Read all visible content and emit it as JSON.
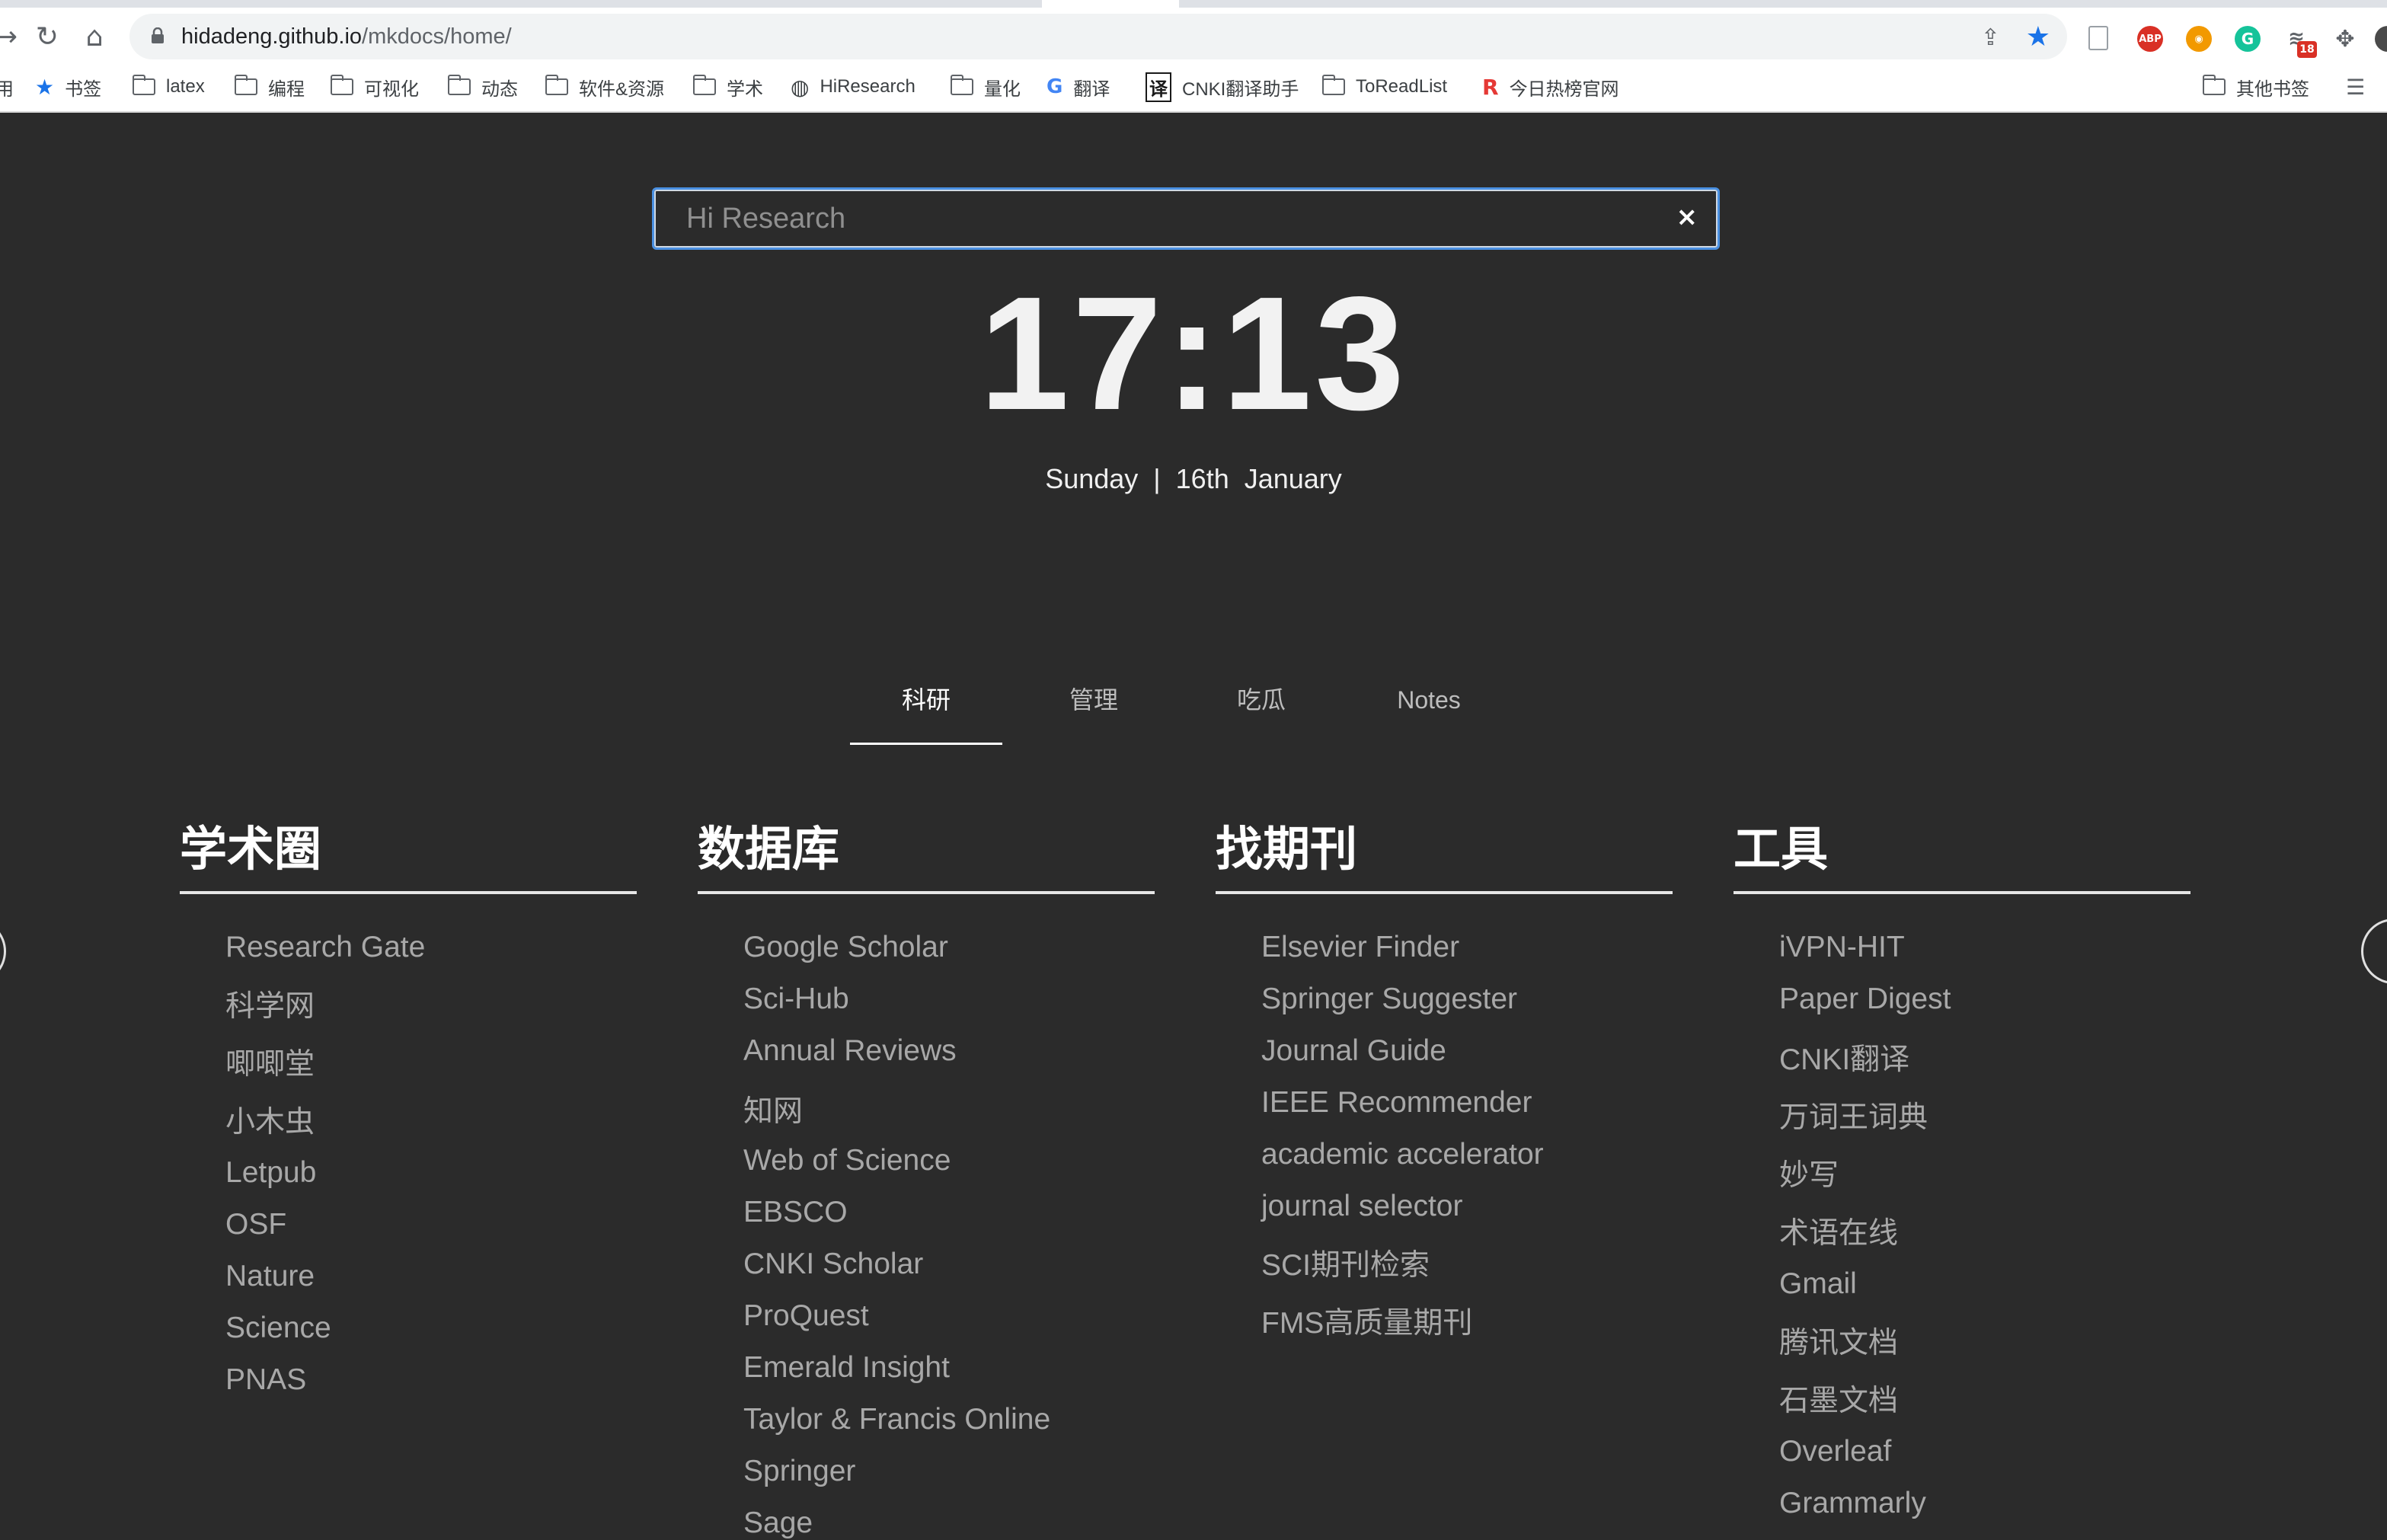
{
  "browser": {
    "url_host": "hidadeng.github.io",
    "url_path": "/mkdocs/home/",
    "extensions": [
      {
        "name": "page-icon"
      },
      {
        "name": "abp-icon",
        "label": "ABP",
        "color": "#d93025"
      },
      {
        "name": "rss-icon",
        "color": "#f29900"
      },
      {
        "name": "grammarly-icon",
        "label": "G",
        "color": "#15c39a"
      },
      {
        "name": "cast-icon",
        "badge": "18",
        "color": "#d93025"
      },
      {
        "name": "puzzle-icon"
      }
    ],
    "bookmarks": [
      {
        "label": "书签",
        "icon": "star-icon"
      },
      {
        "label": "latex",
        "icon": "folder-icon"
      },
      {
        "label": "编程",
        "icon": "folder-icon"
      },
      {
        "label": "可视化",
        "icon": "folder-icon"
      },
      {
        "label": "动态",
        "icon": "folder-icon"
      },
      {
        "label": "软件&资源",
        "icon": "folder-icon"
      },
      {
        "label": "学术",
        "icon": "folder-icon"
      },
      {
        "label": "HiResearch",
        "icon": "globe-icon"
      },
      {
        "label": "量化",
        "icon": "folder-icon"
      },
      {
        "label": "翻译",
        "icon": "translate-icon"
      },
      {
        "label": "CNKI翻译助手",
        "icon": "cnki-icon"
      },
      {
        "label": "ToReadList",
        "icon": "folder-icon"
      },
      {
        "label": "今日热榜官网",
        "icon": "r-icon"
      }
    ],
    "bookmarks_left_edge": "用",
    "other_bookmarks": "其他书签"
  },
  "search": {
    "placeholder": "Hi Research",
    "clear_label": "×"
  },
  "clock": {
    "time": "17:13",
    "date": "Sunday  |  16th  January"
  },
  "tabs": [
    "科研",
    "管理",
    "吃瓜",
    "Notes"
  ],
  "columns": [
    {
      "title": "学术圈",
      "links": [
        "Research Gate",
        "科学网",
        "唧唧堂",
        "小木虫",
        "Letpub",
        "OSF",
        "Nature",
        "Science",
        "PNAS"
      ]
    },
    {
      "title": "数据库",
      "links": [
        "Google Scholar",
        "Sci-Hub",
        "Annual Reviews",
        "知网",
        "Web of Science",
        "EBSCO",
        "CNKI Scholar",
        "ProQuest",
        "Emerald Insight",
        "Taylor & Francis Online",
        "Springer",
        "Sage"
      ]
    },
    {
      "title": "找期刊",
      "links": [
        "Elsevier Finder",
        "Springer Suggester",
        "Journal Guide",
        "IEEE Recommender",
        "academic accelerator",
        "journal selector",
        "SCI期刊检索",
        "FMS高质量期刊"
      ]
    },
    {
      "title": "工具",
      "links": [
        "iVPN-HIT",
        "Paper Digest",
        "CNKI翻译",
        "万词王词典",
        "妙写",
        "术语在线",
        "Gmail",
        "腾讯文档",
        "石墨文档",
        "Overleaf",
        "Grammarly"
      ]
    }
  ]
}
